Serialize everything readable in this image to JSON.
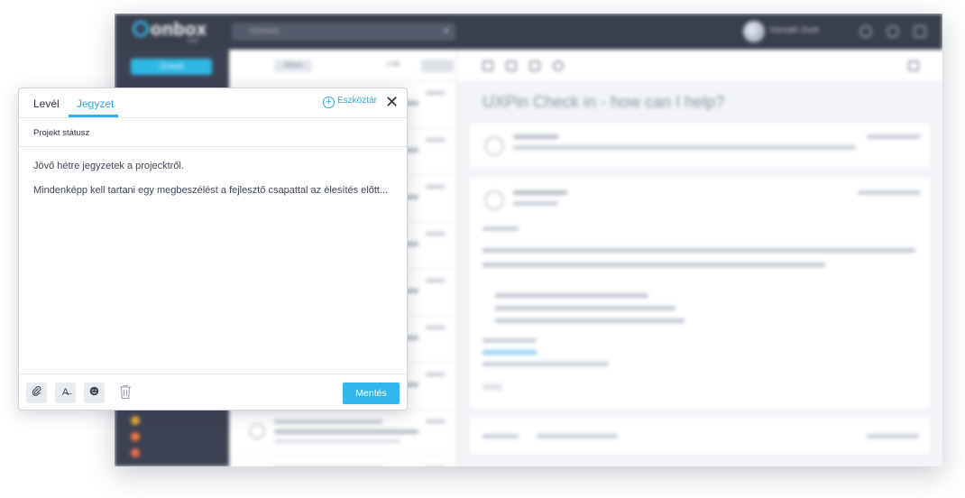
{
  "app": {
    "logo_text": "onbox",
    "logo_sub": "mail",
    "search_placeholder": "Keresés",
    "user_name": "Horváth Zsolt",
    "new_button": "Új levél",
    "list_filter_chip": "Dátum",
    "list_count": "1-50",
    "subject": "UXPin Check in - how can I help?"
  },
  "note": {
    "tabs": [
      {
        "label": "Levél",
        "active": false
      },
      {
        "label": "Jegyzet",
        "active": true
      }
    ],
    "toolbar_label": "Eszköztár",
    "toolbar_icon": "plus-circle-icon",
    "close_icon": "close-icon",
    "title": "Projekt státusz",
    "body_lines": [
      "Jövő hétre jegyzetek a projecktről.",
      "Mindenképp kell tartani egy megbeszélést a fejlesztő csapattal az élesítés előtt..."
    ],
    "footer_icons": [
      "attachment-icon",
      "text-format-icon",
      "emoji-icon",
      "trash-icon"
    ],
    "save_label": "Mentés"
  },
  "colors": {
    "accent": "#32b6ec",
    "topbar": "#3a3f4d",
    "sidebar": "#3d4252"
  }
}
